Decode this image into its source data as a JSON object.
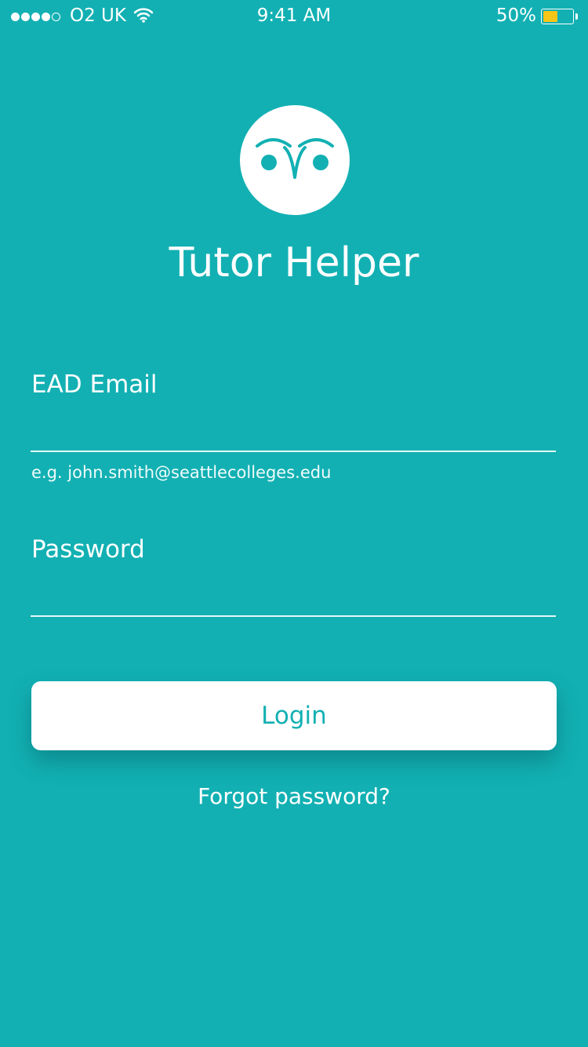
{
  "status_bar": {
    "carrier": "O2 UK",
    "time": "9:41 AM",
    "battery_percent": "50%",
    "battery_level": 0.5,
    "signal_bars_filled": 4,
    "signal_bars_total": 5
  },
  "app": {
    "title": "Tutor Helper",
    "logo_icon": "owl-face-icon"
  },
  "form": {
    "email_label": "EAD Email",
    "email_value": "",
    "email_hint": "e.g. john.smith@seattlecolleges.edu",
    "password_label": "Password",
    "password_value": ""
  },
  "actions": {
    "login_label": "Login",
    "forgot_label": "Forgot password?"
  },
  "colors": {
    "background": "#12b0b3",
    "accent": "#12b0b3",
    "battery_fill": "#f5c518",
    "text": "#ffffff"
  }
}
